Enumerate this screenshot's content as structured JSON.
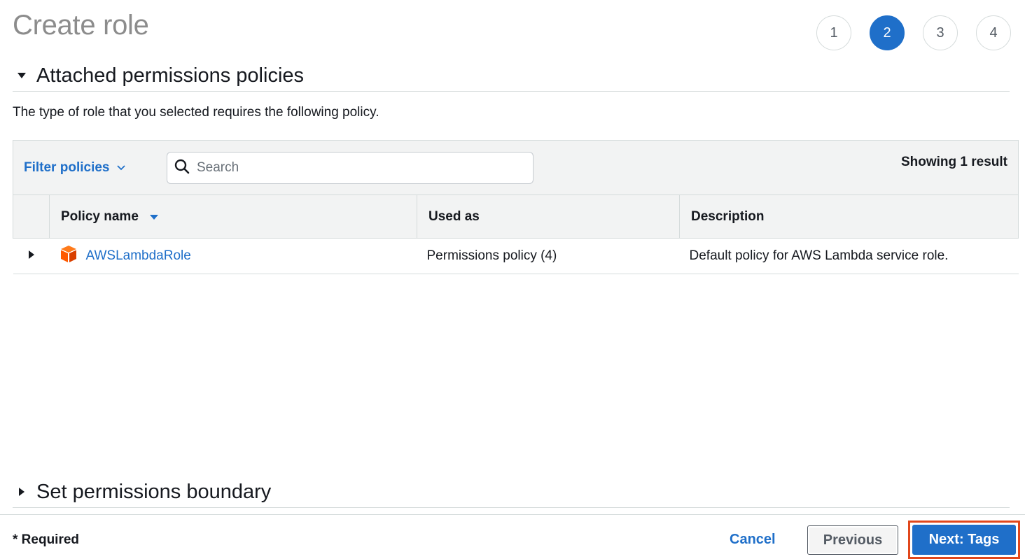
{
  "page": {
    "title": "Create role"
  },
  "steps": [
    "1",
    "2",
    "3",
    "4"
  ],
  "active_step": "2",
  "section_permissions": {
    "title": "Attached permissions policies"
  },
  "intro_text": "The type of role that you selected requires the following policy.",
  "toolbar": {
    "filter_label": "Filter policies",
    "search_placeholder": "Search",
    "showing_text": "Showing 1 result"
  },
  "table": {
    "columns": [
      "Policy name",
      "Used as",
      "Description"
    ],
    "rows": [
      {
        "policy_name": "AWSLambdaRole",
        "used_as": "Permissions policy (4)",
        "description": "Default policy for AWS Lambda service role."
      }
    ]
  },
  "section_boundary": {
    "title": "Set permissions boundary"
  },
  "footer": {
    "required_label": "* Required",
    "cancel_label": "Cancel",
    "previous_label": "Previous",
    "next_label": "Next: Tags"
  },
  "colors": {
    "accent": "#1f6fc9",
    "highlight": "#e1471c",
    "policy_icon": "#ff5a00"
  },
  "icons": [
    "caret-down-icon",
    "caret-right-icon",
    "chevron-down-icon",
    "search-icon",
    "sort-down-icon",
    "aws-package-icon"
  ]
}
